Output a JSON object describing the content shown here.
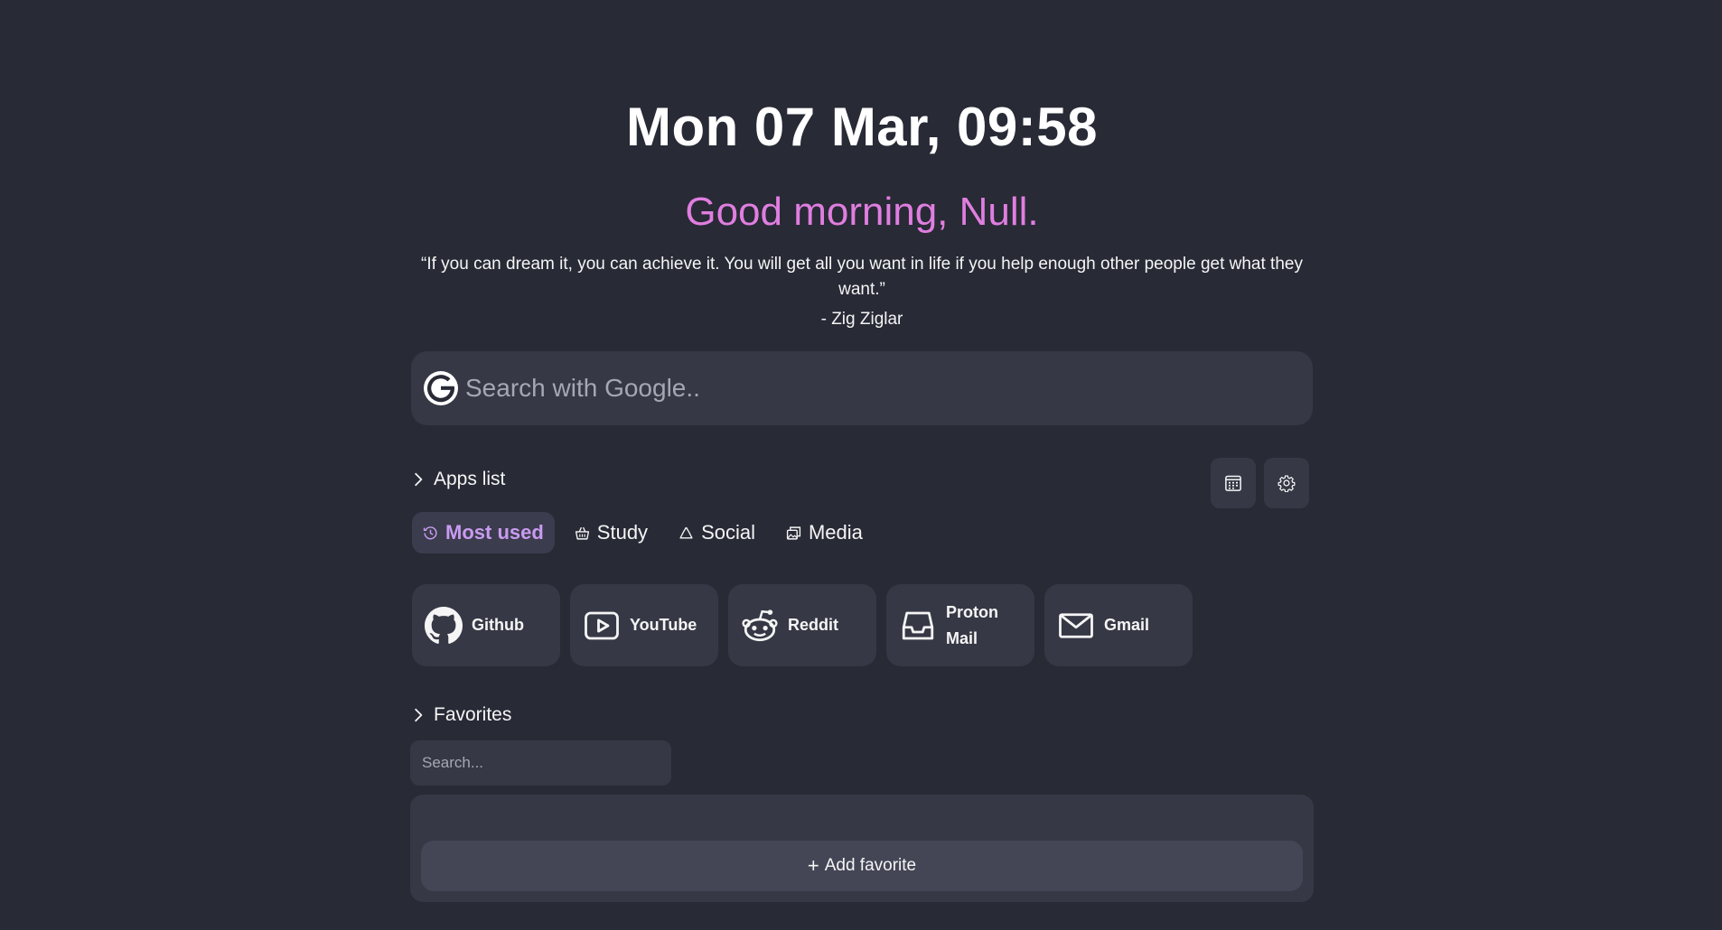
{
  "clock": "Mon 07 Mar, 09:58",
  "greeting": "Good morning, Null.",
  "quote": {
    "text": "“If you can dream it, you can achieve it. You will get all you want in life if you help enough other people get what they want.”",
    "author": "- Zig Ziglar"
  },
  "search": {
    "placeholder": "Search with Google..",
    "engine_icon": "google-icon"
  },
  "apps_section": {
    "title": "Apps list",
    "tabs": [
      {
        "label": "Most used",
        "icon": "clock-history-icon",
        "active": true
      },
      {
        "label": "Study",
        "icon": "basket-icon",
        "active": false
      },
      {
        "label": "Social",
        "icon": "recycle-icon",
        "active": false
      },
      {
        "label": "Media",
        "icon": "images-icon",
        "active": false
      }
    ],
    "apps": [
      {
        "label": "Github",
        "icon": "github-icon"
      },
      {
        "label": "YouTube",
        "icon": "youtube-icon"
      },
      {
        "label": "Reddit",
        "icon": "reddit-icon"
      },
      {
        "label": "Proton Mail",
        "icon": "inbox-icon"
      },
      {
        "label": "Gmail",
        "icon": "envelope-icon"
      }
    ]
  },
  "toolbar": {
    "calendar_icon": "calendar-icon",
    "settings_icon": "gear-icon"
  },
  "favorites": {
    "title": "Favorites",
    "search_placeholder": "Search...",
    "add_label": "Add favorite"
  },
  "colors": {
    "background": "#282a36",
    "card": "#363845",
    "greeting": "#e07ee0",
    "active_tab": "#c99bf0"
  }
}
